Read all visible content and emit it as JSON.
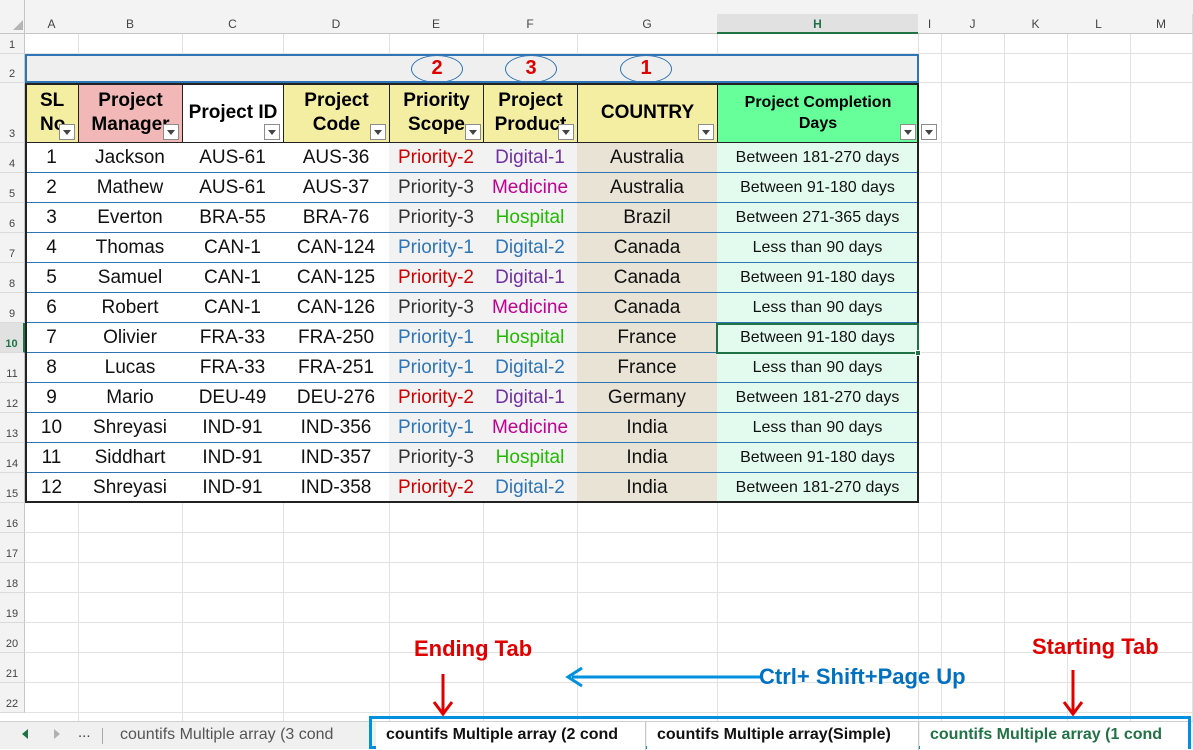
{
  "columns": [
    "A",
    "B",
    "C",
    "D",
    "E",
    "F",
    "G",
    "H",
    "I",
    "J",
    "K",
    "L",
    "M"
  ],
  "selected_column": "H",
  "rows": [
    "1",
    "2",
    "3",
    "4",
    "5",
    "6",
    "7",
    "8",
    "9",
    "10",
    "11",
    "12",
    "13",
    "14",
    "15",
    "16",
    "17",
    "18",
    "19",
    "20",
    "21",
    "22"
  ],
  "selected_row": "10",
  "headers": {
    "sl": "SL No",
    "manager": "Project Manager",
    "project_id": "Project ID",
    "project_code": "Project Code",
    "priority": "Priority Scope",
    "product": "Project Product",
    "country": "COUNTRY",
    "completion": "Project Completion Days"
  },
  "table_rows": [
    {
      "sl": "1",
      "manager": "Jackson",
      "id": "AUS-61",
      "code": "AUS-36",
      "priority": "Priority-2",
      "product": "Digital-1",
      "country": "Australia",
      "days": "Between 181-270 days"
    },
    {
      "sl": "2",
      "manager": "Mathew",
      "id": "AUS-61",
      "code": "AUS-37",
      "priority": "Priority-3",
      "product": "Medicine",
      "country": "Australia",
      "days": "Between 91-180 days"
    },
    {
      "sl": "3",
      "manager": "Everton",
      "id": "BRA-55",
      "code": "BRA-76",
      "priority": "Priority-3",
      "product": "Hospital",
      "country": "Brazil",
      "days": "Between 271-365 days"
    },
    {
      "sl": "4",
      "manager": "Thomas",
      "id": "CAN-1",
      "code": "CAN-124",
      "priority": "Priority-1",
      "product": "Digital-2",
      "country": "Canada",
      "days": "Less than 90 days"
    },
    {
      "sl": "5",
      "manager": "Samuel",
      "id": "CAN-1",
      "code": "CAN-125",
      "priority": "Priority-2",
      "product": "Digital-1",
      "country": "Canada",
      "days": "Between 91-180 days"
    },
    {
      "sl": "6",
      "manager": "Robert",
      "id": "CAN-1",
      "code": "CAN-126",
      "priority": "Priority-3",
      "product": "Medicine",
      "country": "Canada",
      "days": "Less than 90 days"
    },
    {
      "sl": "7",
      "manager": "Olivier",
      "id": "FRA-33",
      "code": "FRA-250",
      "priority": "Priority-1",
      "product": "Hospital",
      "country": "France",
      "days": "Between 91-180 days"
    },
    {
      "sl": "8",
      "manager": "Lucas",
      "id": "FRA-33",
      "code": "FRA-251",
      "priority": "Priority-1",
      "product": "Digital-2",
      "country": "France",
      "days": "Less than 90 days"
    },
    {
      "sl": "9",
      "manager": "Mario",
      "id": "DEU-49",
      "code": "DEU-276",
      "priority": "Priority-2",
      "product": "Digital-1",
      "country": "Germany",
      "days": "Between 181-270 days"
    },
    {
      "sl": "10",
      "manager": "Shreyasi",
      "id": "IND-91",
      "code": "IND-356",
      "priority": "Priority-1",
      "product": "Medicine",
      "country": "India",
      "days": "Less than 90 days"
    },
    {
      "sl": "11",
      "manager": "Siddhart",
      "id": "IND-91",
      "code": "IND-357",
      "priority": "Priority-3",
      "product": "Hospital",
      "country": "India",
      "days": "Between 91-180 days"
    },
    {
      "sl": "12",
      "manager": "Shreyasi",
      "id": "IND-91",
      "code": "IND-358",
      "priority": "Priority-2",
      "product": "Digital-2",
      "country": "India",
      "days": "Between 181-270 days"
    }
  ],
  "value_colors": {
    "Priority-1": "#2e75b6",
    "Priority-2": "#d00000",
    "Priority-3": "#333333",
    "Digital-1": "#7030a0",
    "Digital-2": "#2e75b6",
    "Medicine": "#c00090",
    "Hospital": "#22bb00"
  },
  "fills": {
    "sl_header": "#f3eea1",
    "manager_header": "#f2b8b8",
    "id_header": "#ffffff",
    "code_header": "#f3eea1",
    "priority_header": "#f3eea1",
    "product_header": "#f3eea1",
    "country_header": "#f3eea1",
    "completion_header": "#66ff99",
    "priority_col": "#f2f2f2",
    "product_col": "#f2f2f2",
    "country_col": "#e8e3d4",
    "completion_col": "#e3fbef",
    "title_bar": "#efefef",
    "accent_blue": "#0070c0",
    "accent_red": "#e00000"
  },
  "annotations": {
    "circle_priority": "2",
    "circle_product": "3",
    "circle_country": "1",
    "ending_tab": "Ending Tab",
    "starting_tab": "Starting Tab",
    "shortcut": "Ctrl+ Shift+Page Up"
  },
  "tabs": {
    "ellipsis": "...",
    "tab1": "countifs Multiple array (3 cond",
    "tab2": "countifs Multiple array (2 cond",
    "tab3": "countifs Multiple array(Simple)",
    "tab4": "countifs Multiple array (1 cond"
  }
}
